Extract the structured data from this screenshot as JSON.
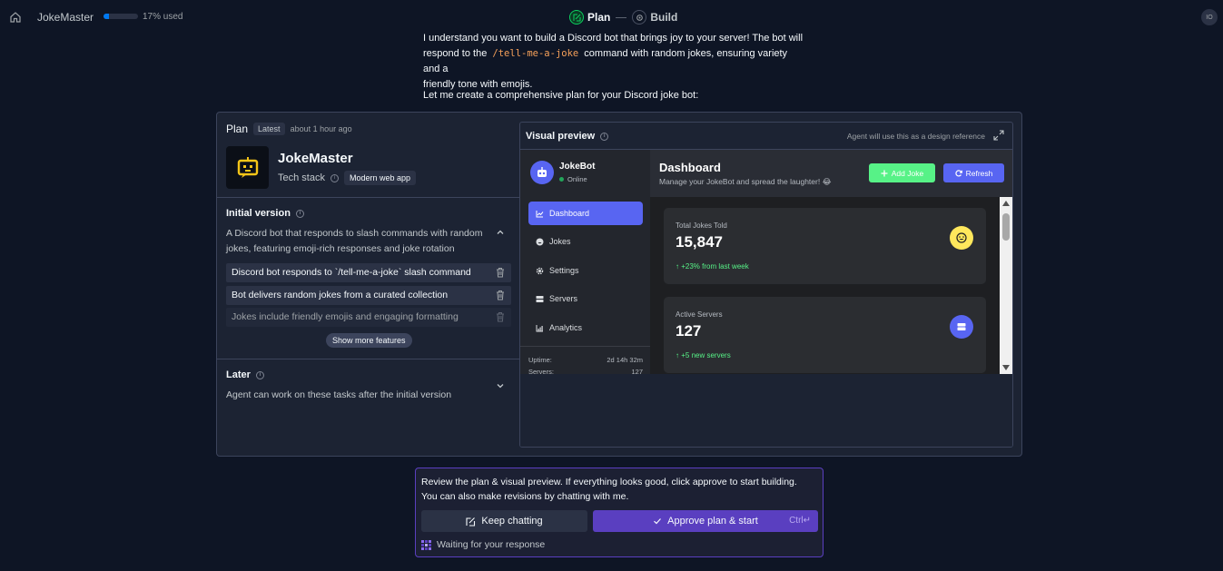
{
  "topbar": {
    "app_name": "JokeMaster",
    "usage_percent": 17,
    "usage_text": "17% used",
    "steps": [
      {
        "label": "Plan",
        "active": true
      },
      {
        "label": "Build",
        "active": false
      }
    ],
    "avatar_initials": "IO"
  },
  "message": {
    "intro_line1": "I understand you want to build a Discord bot that brings joy to your server! The bot will",
    "intro_line2_prefix": "respond to the",
    "command": "/tell-me-a-joke",
    "intro_line2_suffix": "command with random jokes, ensuring variety and a",
    "intro_line3": "friendly tone with emojis.",
    "plan_intro": "Let me create a comprehensive plan for your Discord joke bot:"
  },
  "plan": {
    "title": "Plan",
    "tag": "Latest",
    "time": "about 1 hour ago",
    "project_name": "JokeMaster",
    "stack_label": "Tech stack",
    "stack_value": "Modern web app",
    "initial_title": "Initial version",
    "initial_desc": "A Discord bot that responds to slash commands with random jokes, featuring emoji-rich responses and joke rotation",
    "features": [
      "Discord bot responds to `/tell-me-a-joke` slash command",
      "Bot delivers random jokes from a curated collection",
      "Jokes include friendly emojis and engaging formatting"
    ],
    "show_more": "Show more features",
    "later_title": "Later",
    "later_desc": "Agent can work on these tasks after the initial version"
  },
  "preview": {
    "title": "Visual preview",
    "note": "Agent will use this as a design reference",
    "bot_name": "JokeBot",
    "bot_status": "Online",
    "nav": [
      "Dashboard",
      "Jokes",
      "Settings",
      "Servers",
      "Analytics"
    ],
    "active_nav": "Dashboard",
    "uptime_label": "Uptime:",
    "uptime_value": "2d 14h 32m",
    "servers_label": "Servers:",
    "servers_value": "127",
    "dashboard_title": "Dashboard",
    "dashboard_sub": "Manage your JokeBot and spread the laughter! 😂",
    "add_joke": "Add Joke",
    "refresh": "Refresh",
    "cards": [
      {
        "label": "Total Jokes Told",
        "value": "15,847",
        "delta": "+23% from last week",
        "icon": "smile-icon",
        "color": "#fee75c"
      },
      {
        "label": "Active Servers",
        "value": "127",
        "delta": "+5 new servers",
        "icon": "server-icon",
        "color": "#5865f2"
      }
    ]
  },
  "review": {
    "text_line1": "Review the plan & visual preview. If everything looks good, click approve to start building.",
    "text_line2": "You can also make revisions by chatting with me.",
    "keep_chatting": "Keep chatting",
    "approve": "Approve plan & start",
    "shortcut": "Ctrl↵",
    "waiting": "Waiting for your response"
  }
}
